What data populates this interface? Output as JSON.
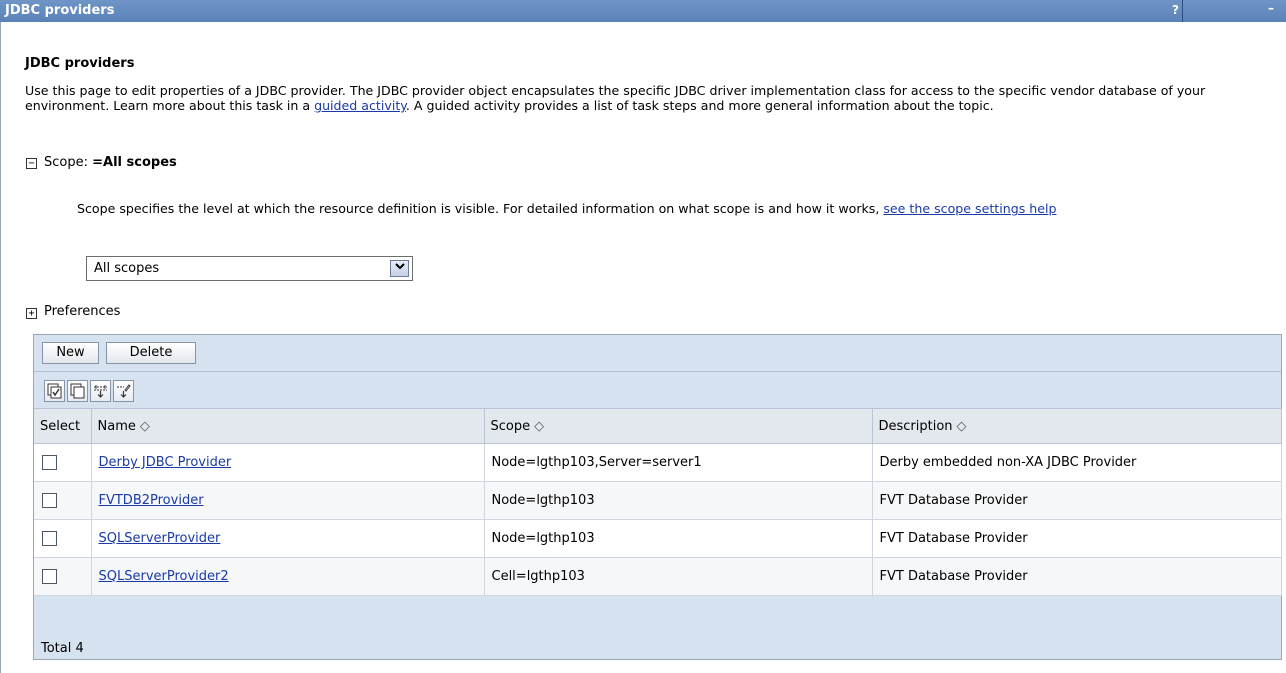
{
  "window": {
    "title": "JDBC providers",
    "help_label": "?",
    "minimize_label": "–"
  },
  "page": {
    "heading": "JDBC providers",
    "description_part1": "Use this page to edit properties of a JDBC provider. The JDBC provider object encapsulates the specific JDBC driver implementation class for access to the specific vendor database of your environment. Learn more about this task in a ",
    "description_link": "guided activity",
    "description_part2": ". A guided activity provides a list of task steps and more general information about the topic."
  },
  "scope": {
    "toggle": "−",
    "label": "Scope: ",
    "value_label": "=All scopes",
    "help_text": "Scope specifies the level at which the resource definition is visible. For detailed information on what scope is and how it works, ",
    "help_link": "see the scope settings help",
    "select_value": "All scopes"
  },
  "preferences": {
    "toggle": "+",
    "label": "Preferences"
  },
  "toolbar": {
    "new_label": "New",
    "delete_label": "Delete"
  },
  "table": {
    "columns": {
      "select": "Select",
      "name": "Name",
      "scope": "Scope",
      "description": "Description"
    },
    "rows": [
      {
        "name": "Derby JDBC Provider",
        "scope": "Node=lgthp103,Server=server1",
        "description": "Derby embedded non-XA JDBC Provider"
      },
      {
        "name": "FVTDB2Provider",
        "scope": "Node=lgthp103",
        "description": "FVT Database Provider"
      },
      {
        "name": "SQLServerProvider",
        "scope": "Node=lgthp103",
        "description": "FVT Database Provider"
      },
      {
        "name": "SQLServerProvider2",
        "scope": "Cell=lgthp103",
        "description": "FVT Database Provider"
      }
    ],
    "total": "Total 4"
  },
  "icons": [
    "select-all-icon",
    "deselect-all-icon",
    "show-filter-icon",
    "clear-filter-icon"
  ]
}
